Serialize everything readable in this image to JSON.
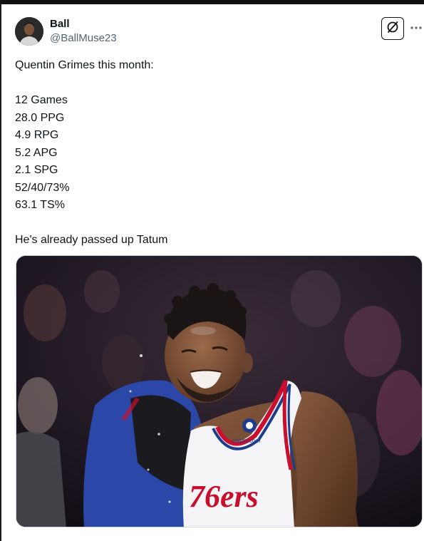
{
  "post": {
    "author": {
      "display_name": "Ball",
      "handle": "@BallMuse23"
    },
    "text_lines": [
      "Quentin Grimes this month:",
      "",
      "12 Games",
      "28.0 PPG",
      "4.9 RPG",
      "5.2 APG",
      "2.1 SPG",
      "52/40/73%",
      "63.1 TS%",
      "",
      "He's already passed up Tatum"
    ],
    "media": {
      "jersey_text": "76ers",
      "jersey_sponsor": "crypto.com"
    }
  },
  "icons": {
    "grok": "grok-icon",
    "more": "more-options-icon"
  },
  "colors": {
    "text_primary": "#0f1419",
    "text_secondary": "#536471",
    "jersey_red": "#c8102e",
    "jersey_blue": "#1d3c8c"
  }
}
